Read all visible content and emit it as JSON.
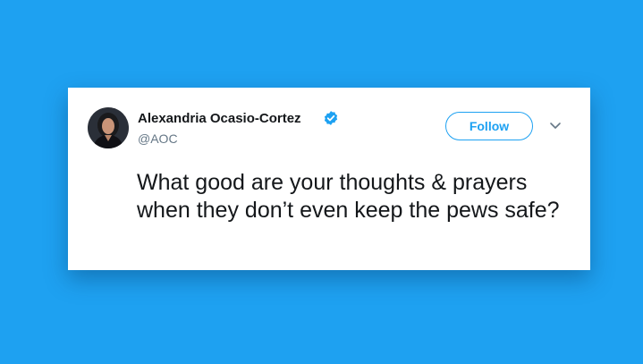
{
  "tweet": {
    "display_name": "Alexandria Ocasio-Cortez",
    "handle": "@AOC",
    "follow_label": "Follow",
    "text": "What good are your thoughts & prayers when they don’t even keep the pews safe?"
  },
  "icons": {
    "verified": "verified-badge-icon",
    "caret": "chevron-down-icon",
    "avatar": "profile-photo"
  },
  "colors": {
    "background": "#1ea1f1",
    "accent": "#1da1f2",
    "name_text": "#14171a",
    "handle_text": "#657786",
    "card": "#ffffff"
  }
}
